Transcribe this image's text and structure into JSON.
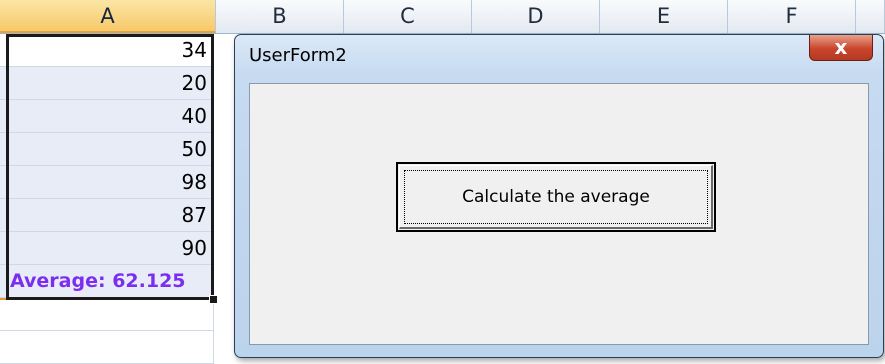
{
  "columns": [
    "A",
    "B",
    "C",
    "D",
    "E",
    "F"
  ],
  "cells_a": [
    "34",
    "20",
    "40",
    "50",
    "98",
    "87",
    "90",
    "Average: 62.125"
  ],
  "userform": {
    "title": "UserForm2",
    "close_glyph": "x",
    "button_label": "Calculate the average"
  },
  "colors": {
    "average_text": "#7b2ef0",
    "selected_header": "#f7c96a",
    "close_button": "#c9452c"
  },
  "icons": {
    "close": "close-icon"
  }
}
